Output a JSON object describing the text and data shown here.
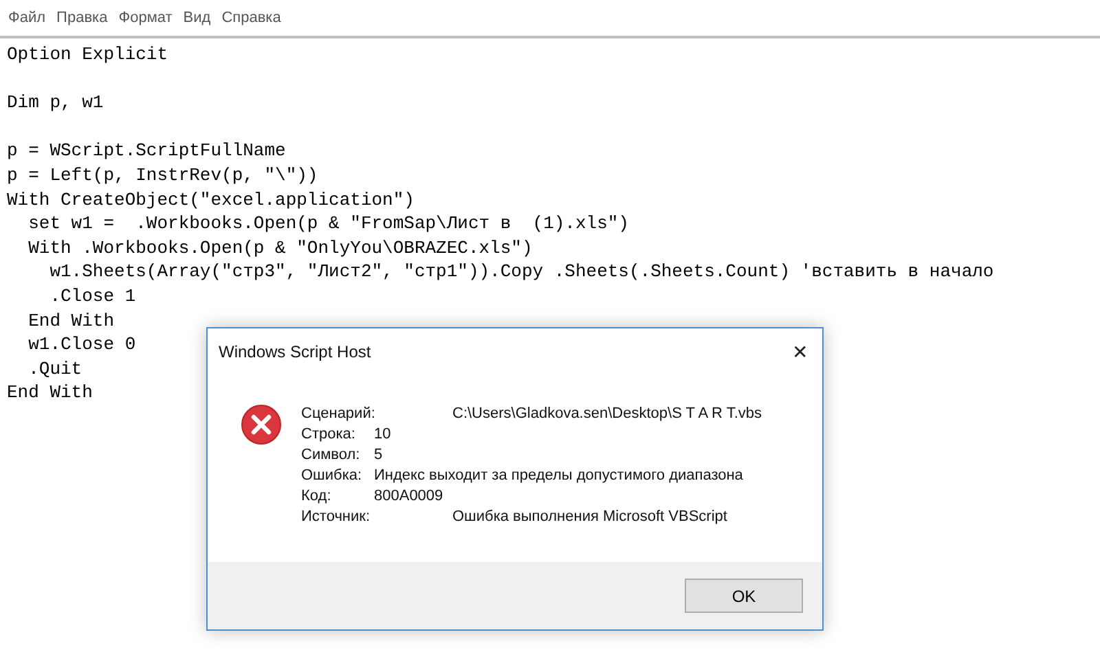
{
  "menu": [
    "Файл",
    "Правка",
    "Формат",
    "Вид",
    "Справка"
  ],
  "code_blocks": [
    [
      "Option Explicit"
    ],
    [
      "Dim p, w1"
    ],
    [
      "p = WScript.ScriptFullName",
      "p = Left(p, InstrRev(p, \"\\\"))",
      "With CreateObject(\"excel.application\")",
      "  set w1 =  .Workbooks.Open(p & \"FromSap\\Лист в  (1).xls\")",
      "  With .Workbooks.Open(p & \"OnlyYou\\OBRAZEC.xls\")",
      "    w1.Sheets(Array(\"стр3\", \"Лист2\", \"стр1\")).Copy .Sheets(.Sheets.Count) 'вставить в начало",
      "    .Close 1",
      "  End With",
      "  w1.Close 0",
      "  .Quit",
      "End With"
    ]
  ],
  "dialog": {
    "title": "Windows Script Host",
    "close": "✕",
    "rows": [
      {
        "label": "Сценарий:",
        "value": "C:\\Users\\Gladkova.sen\\Desktop\\S T A R T.vbs",
        "kind": "wide"
      },
      {
        "label": "Строка:",
        "value": "10",
        "kind": "tight"
      },
      {
        "label": "Символ:",
        "value": "5",
        "kind": "tight"
      },
      {
        "label": "Ошибка:",
        "value": "Индекс выходит за пределы допустимого диапазона",
        "kind": "tight"
      },
      {
        "label": "Код:",
        "value": "800A0009",
        "kind": "tight"
      },
      {
        "label": "Источник:",
        "value": "Ошибка выполнения Microsoft VBScript",
        "kind": "wide"
      }
    ],
    "button": "OK"
  }
}
